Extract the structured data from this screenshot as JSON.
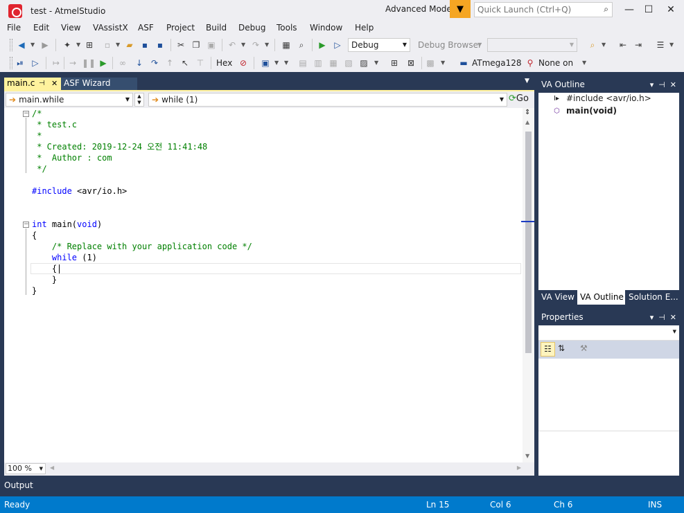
{
  "titlebar": {
    "title": "test - AtmelStudio",
    "advanced_mode": "Advanced Mode",
    "quick_launch_placeholder": "Quick Launch (Ctrl+Q)",
    "minimize": "—",
    "maximize": "☐",
    "close": "✕"
  },
  "menu": [
    "File",
    "Edit",
    "View",
    "VAssistX",
    "ASF",
    "Project",
    "Build",
    "Debug",
    "Tools",
    "Window",
    "Help"
  ],
  "toolbar1": {
    "config": "Debug",
    "debug_browser": "Debug Browser"
  },
  "toolbar2": {
    "hex": "Hex",
    "device": "ATmega128",
    "tool": "None on"
  },
  "tabs": {
    "main": "main.c",
    "asf": "ASF Wizard"
  },
  "navbar": {
    "scope": "main.while",
    "member": "while (1)",
    "go": "Go"
  },
  "code": {
    "l1": "/*",
    "l2": " * test.c",
    "l3": " *",
    "l4": " * Created: 2019-12-24 오전 11:41:48",
    "l5": " *  Author : com",
    "l6": " */",
    "l7_kw": "#include",
    "l7_rest": " <avr/io.h>",
    "l8_kw": "int",
    "l8_rest": " main(",
    "l8_kw2": "void",
    "l8_end": ")",
    "l9": "{",
    "l10": "    /* Replace with your application code */",
    "l11_kw": "while",
    "l11_rest": " (1)",
    "l12": "    {",
    "l13": "    }",
    "l14": "}"
  },
  "zoom": "100 %",
  "va_outline": {
    "title": "VA Outline",
    "items": [
      "#include <avr/io.h>",
      "main(void)"
    ],
    "tabs": [
      "VA View",
      "VA Outline",
      "Solution E..."
    ]
  },
  "properties": {
    "title": "Properties"
  },
  "output": "Output",
  "status": {
    "ready": "Ready",
    "ln": "Ln 15",
    "col": "Col 6",
    "ch": "Ch 6",
    "ins": "INS"
  }
}
